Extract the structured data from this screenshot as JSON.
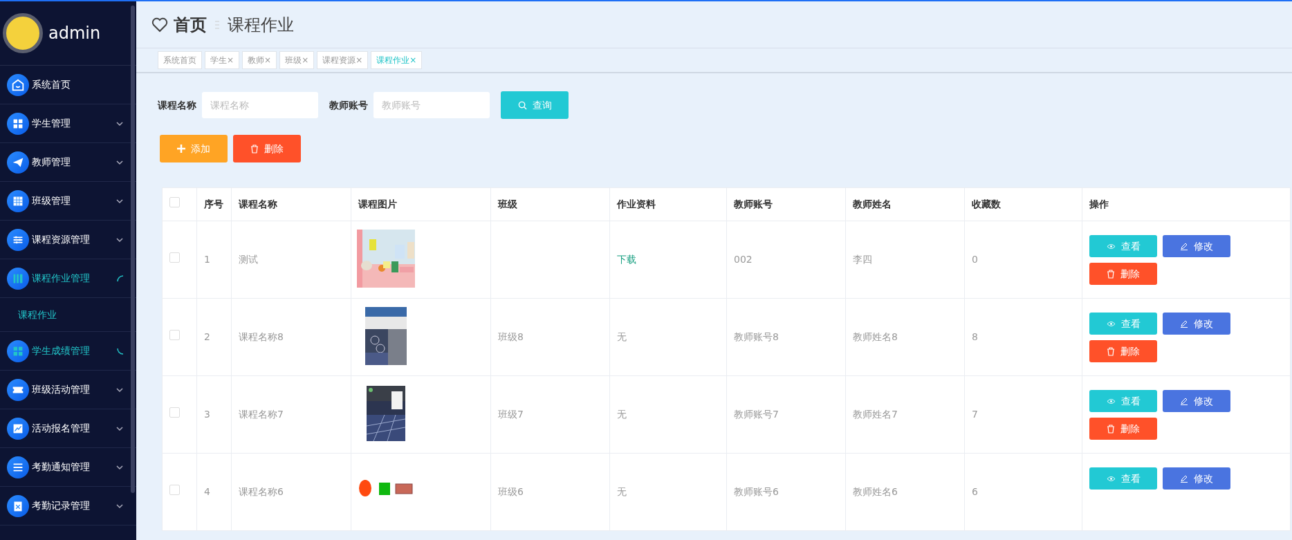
{
  "sidebar": {
    "user": "admin",
    "items": [
      {
        "label": "系统首页",
        "highlighted": false
      },
      {
        "label": "学生管理",
        "highlighted": false,
        "expanded": false
      },
      {
        "label": "教师管理",
        "highlighted": false,
        "expanded": false
      },
      {
        "label": "班级管理",
        "highlighted": false,
        "expanded": false
      },
      {
        "label": "课程资源管理",
        "highlighted": false,
        "expanded": false
      },
      {
        "label": "课程作业管理",
        "highlighted": true,
        "expanded": true,
        "children": [
          {
            "label": "课程作业"
          }
        ]
      },
      {
        "label": "学生成绩管理",
        "highlighted": true,
        "expanded": false
      },
      {
        "label": "班级活动管理",
        "highlighted": false,
        "expanded": false
      },
      {
        "label": "活动报名管理",
        "highlighted": false,
        "expanded": false
      },
      {
        "label": "考勤通知管理",
        "highlighted": false,
        "expanded": false
      },
      {
        "label": "考勤记录管理",
        "highlighted": false,
        "expanded": false
      }
    ]
  },
  "header": {
    "home": "首页",
    "page": "课程作业"
  },
  "tabs": [
    {
      "label": "系统首页",
      "selected": false
    },
    {
      "label": "学生",
      "selected": false,
      "close": "×"
    },
    {
      "label": "教师",
      "selected": false,
      "close": "×"
    },
    {
      "label": "班级",
      "selected": false,
      "close": "×"
    },
    {
      "label": "课程资源",
      "selected": false,
      "close": "×"
    },
    {
      "label": "课程作业",
      "selected": true,
      "close": "×"
    }
  ],
  "search": {
    "fields": [
      {
        "label": "课程名称",
        "placeholder": "课程名称"
      },
      {
        "label": "教师账号",
        "placeholder": "教师账号"
      }
    ],
    "button": "查询"
  },
  "actions": [
    {
      "kind": "add",
      "label": "添加"
    },
    {
      "kind": "delete",
      "label": "删除"
    }
  ],
  "table": {
    "all_checked": false,
    "columns": [
      "序号",
      "课程名称",
      "课程图片",
      "班级",
      "作业资料",
      "教师账号",
      "教师姓名",
      "收藏数",
      "操作"
    ],
    "rows": [
      {
        "checked": false,
        "cells": [
          "1",
          "测试",
          "",
          "",
          "下载",
          "002",
          "李四",
          "0"
        ],
        "actions": [
          {
            "kind": "view",
            "label": "查看"
          },
          {
            "kind": "edit",
            "label": "修改"
          },
          {
            "kind": "delete",
            "label": "删除"
          }
        ]
      },
      {
        "checked": false,
        "cells": [
          "2",
          "课程名称8",
          "",
          "班级8",
          "无",
          "教师账号8",
          "教师姓名8",
          "8"
        ],
        "actions": [
          {
            "kind": "view",
            "label": "查看"
          },
          {
            "kind": "edit",
            "label": "修改"
          },
          {
            "kind": "delete",
            "label": "删除"
          }
        ]
      },
      {
        "checked": false,
        "cells": [
          "3",
          "课程名称7",
          "",
          "班级7",
          "无",
          "教师账号7",
          "教师姓名7",
          "7"
        ],
        "actions": [
          {
            "kind": "view",
            "label": "查看"
          },
          {
            "kind": "edit",
            "label": "修改"
          },
          {
            "kind": "delete",
            "label": "删除"
          }
        ]
      },
      {
        "checked": false,
        "cells": [
          "4",
          "课程名称6",
          "",
          "班级6",
          "无",
          "教师账号6",
          "教师姓名6",
          "6"
        ],
        "actions": [
          {
            "kind": "view",
            "label": "查看"
          },
          {
            "kind": "edit",
            "label": "修改"
          }
        ]
      }
    ]
  }
}
